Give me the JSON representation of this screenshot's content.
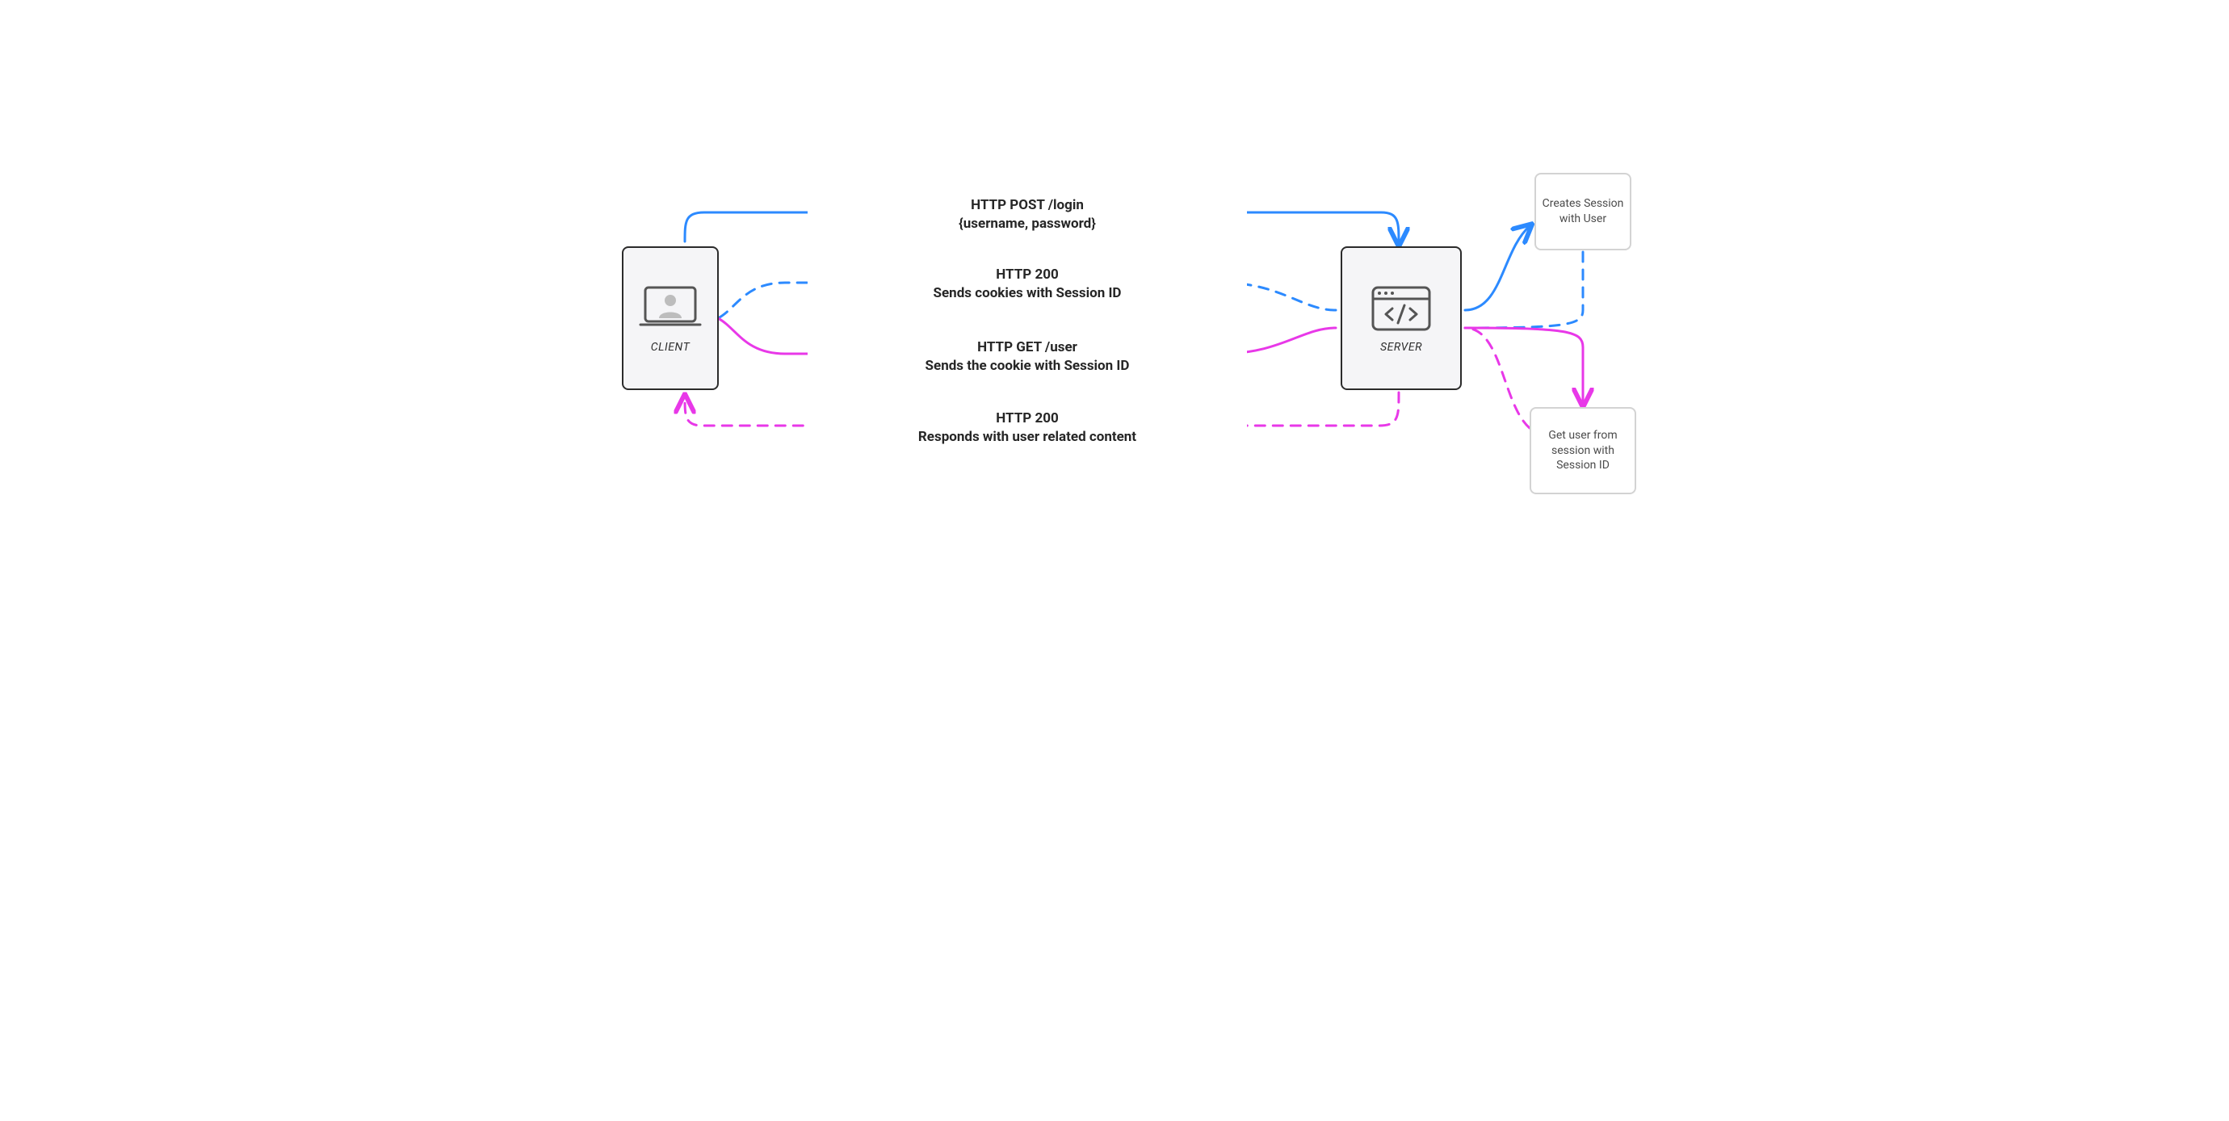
{
  "nodes": {
    "client": {
      "label": "CLIENT"
    },
    "server": {
      "label": "SERVER"
    },
    "side_create": {
      "label": "Creates Session with User"
    },
    "side_get": {
      "label": "Get user from session with Session ID"
    }
  },
  "flows": {
    "post_login": {
      "line1": "HTTP POST /login",
      "line2": "{username, password}"
    },
    "resp_cookies": {
      "line1": "HTTP 200",
      "line2": "Sends cookies with Session ID"
    },
    "get_user": {
      "line1": "HTTP GET /user",
      "line2": "Sends the cookie with Session ID"
    },
    "resp_content": {
      "line1": "HTTP 200",
      "line2": "Responds with user related content"
    }
  },
  "colors": {
    "blue": "#2c8aff",
    "pink": "#e838e8"
  }
}
